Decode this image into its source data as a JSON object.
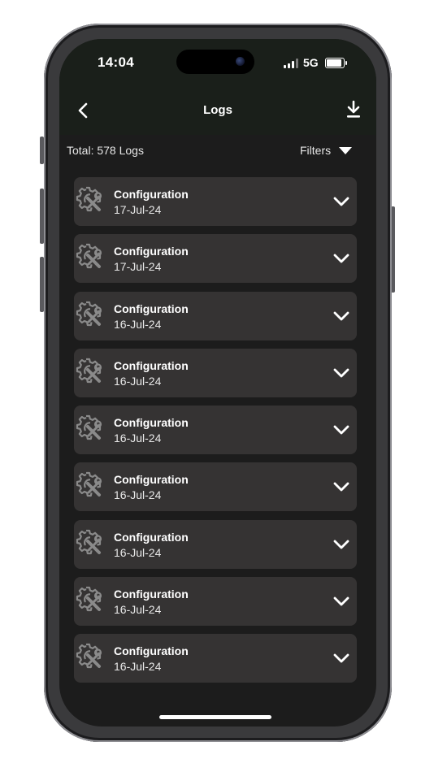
{
  "status_bar": {
    "time": "14:04",
    "network": "5G",
    "icons": [
      "signal-icon",
      "battery-icon"
    ]
  },
  "nav": {
    "title": "Logs",
    "icons": [
      "back-chevron-icon",
      "download-icon"
    ]
  },
  "summary": {
    "total": "Total: 578 Logs",
    "filters_label": "Filters"
  },
  "logs": [
    {
      "title": "Configuration",
      "date": "17-Jul-24"
    },
    {
      "title": "Configuration",
      "date": "17-Jul-24"
    },
    {
      "title": "Configuration",
      "date": "16-Jul-24"
    },
    {
      "title": "Configuration",
      "date": "16-Jul-24"
    },
    {
      "title": "Configuration",
      "date": "16-Jul-24"
    },
    {
      "title": "Configuration",
      "date": "16-Jul-24"
    },
    {
      "title": "Configuration",
      "date": "16-Jul-24"
    },
    {
      "title": "Configuration",
      "date": "16-Jul-24"
    },
    {
      "title": "Configuration",
      "date": "16-Jul-24"
    }
  ],
  "colors": {
    "screen_background": "#1c1c1c",
    "header_background": "#1a1f1a",
    "card_background": "#353333",
    "text": "#ffffff",
    "icon_gray": "#8a8a8a"
  }
}
